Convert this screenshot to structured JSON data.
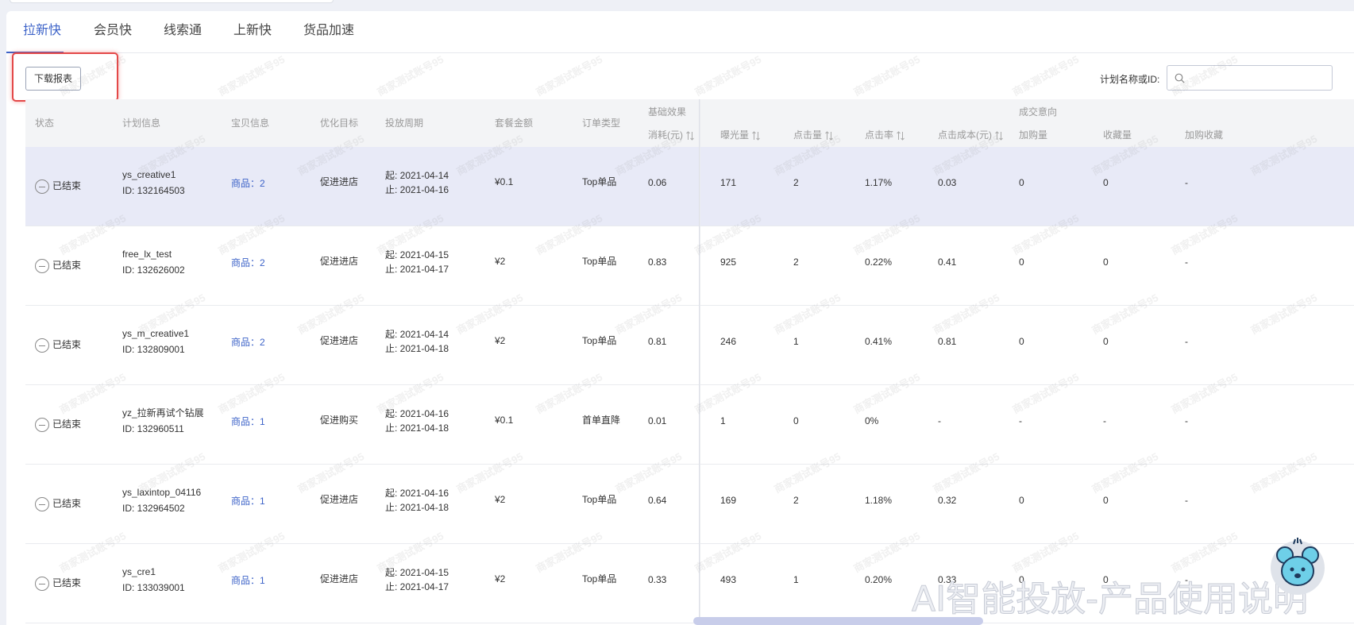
{
  "tabs": [
    {
      "label": "拉新快"
    },
    {
      "label": "会员快"
    },
    {
      "label": "线索通"
    },
    {
      "label": "上新快"
    },
    {
      "label": "货品加速"
    }
  ],
  "toolbar": {
    "download_label": "下载报表"
  },
  "search": {
    "label": "计划名称或ID:",
    "placeholder": ""
  },
  "columns": {
    "status": "状态",
    "plan": "计划信息",
    "item": "宝贝信息",
    "goal": "优化目标",
    "period": "投放周期",
    "amount": "套餐金额",
    "order_type": "订单类型",
    "group_basic": "基础效果",
    "group_deal": "成交意向",
    "cost": "消耗(元)",
    "impressions": "曝光量",
    "clicks": "点击量",
    "ctr": "点击率",
    "cpc": "点击成本(元)",
    "cart": "加购量",
    "fav": "收藏量",
    "cartfav": "加购收藏"
  },
  "rows": [
    {
      "status": "已结束",
      "name": "ys_creative1",
      "id": "ID: 132164503",
      "item": "商品：2",
      "goal": "促进进店",
      "start": "起:  2021-04-14",
      "end": "止:  2021-04-16",
      "amount": "¥0.1",
      "order_type": "Top单品",
      "cost": "0.06",
      "impressions": "171",
      "clicks": "2",
      "ctr": "1.17%",
      "cpc": "0.03",
      "cart": "0",
      "fav": "0",
      "cartfav": "-"
    },
    {
      "status": "已结束",
      "name": "free_lx_test",
      "id": "ID: 132626002",
      "item": "商品：2",
      "goal": "促进进店",
      "start": "起:  2021-04-15",
      "end": "止:  2021-04-17",
      "amount": "¥2",
      "order_type": "Top单品",
      "cost": "0.83",
      "impressions": "925",
      "clicks": "2",
      "ctr": "0.22%",
      "cpc": "0.41",
      "cart": "0",
      "fav": "0",
      "cartfav": "-"
    },
    {
      "status": "已结束",
      "name": "ys_m_creative1",
      "id": "ID: 132809001",
      "item": "商品：2",
      "goal": "促进进店",
      "start": "起:  2021-04-14",
      "end": "止:  2021-04-18",
      "amount": "¥2",
      "order_type": "Top单品",
      "cost": "0.81",
      "impressions": "246",
      "clicks": "1",
      "ctr": "0.41%",
      "cpc": "0.81",
      "cart": "0",
      "fav": "0",
      "cartfav": "-"
    },
    {
      "status": "已结束",
      "name": "yz_拉新再试个钻展",
      "id": "ID: 132960511",
      "item": "商品：1",
      "goal": "促进购买",
      "start": "起:  2021-04-16",
      "end": "止:  2021-04-18",
      "amount": "¥0.1",
      "order_type": "首单直降",
      "cost": "0.01",
      "impressions": "1",
      "clicks": "0",
      "ctr": "0%",
      "cpc": "-",
      "cart": "-",
      "fav": "-",
      "cartfav": "-"
    },
    {
      "status": "已结束",
      "name": "ys_laxintop_04116",
      "id": "ID: 132964502",
      "item": "商品：1",
      "goal": "促进进店",
      "start": "起:  2021-04-16",
      "end": "止:  2021-04-18",
      "amount": "¥2",
      "order_type": "Top单品",
      "cost": "0.64",
      "impressions": "169",
      "clicks": "2",
      "ctr": "1.18%",
      "cpc": "0.32",
      "cart": "0",
      "fav": "0",
      "cartfav": "-"
    },
    {
      "status": "已结束",
      "name": "ys_cre1",
      "id": "ID: 133039001",
      "item": "商品：1",
      "goal": "促进进店",
      "start": "起:  2021-04-15",
      "end": "止:  2021-04-17",
      "amount": "¥2",
      "order_type": "Top单品",
      "cost": "0.33",
      "impressions": "493",
      "clicks": "1",
      "ctr": "0.20%",
      "cpc": "0.33",
      "cart": "0",
      "fav": "0",
      "cartfav": "-"
    }
  ],
  "watermark_text": "商家测试账号95",
  "caption": "AI智能投放-产品使用说明",
  "colors": {
    "accent": "#3d63c8",
    "highlight_row": "#e8eaf7",
    "annotation": "#e44848"
  }
}
